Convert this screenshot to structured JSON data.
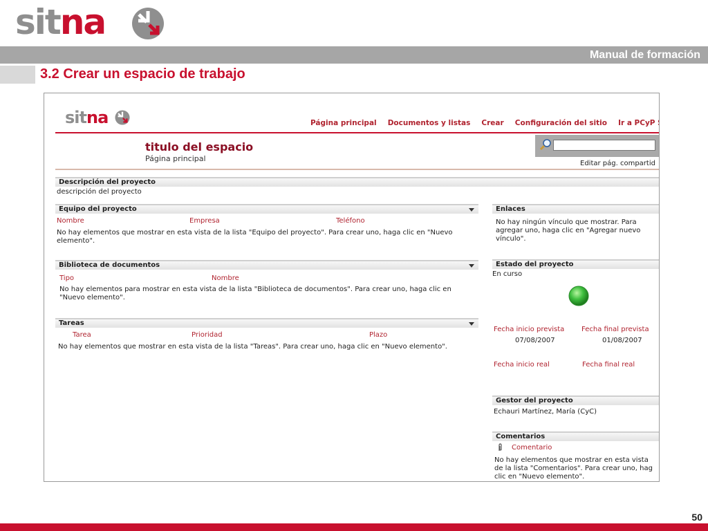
{
  "brand": {
    "sit": "sit",
    "na": "na"
  },
  "slide": {
    "band_text": "Manual de formación",
    "title": "3.2 Crear un espacio de trabajo",
    "page_number": "50"
  },
  "app": {
    "logo": {
      "sit": "sit",
      "na": "na"
    },
    "nav": [
      "Página principal",
      "Documentos y listas",
      "Crear",
      "Configuración del sitio",
      "Ir a PCyP SIT"
    ],
    "site_title": "titulo del espacio",
    "site_subtitle": "Página principal",
    "edit_link": "Editar pág. compartid",
    "description": {
      "header": "Descripción del proyecto",
      "text": "descripción del proyecto"
    },
    "team": {
      "header": "Equipo del proyecto",
      "columns": [
        "Nombre",
        "Empresa",
        "Teléfono"
      ],
      "empty_lines": [
        "No hay elementos que mostrar en esta vista de la lista \"Equipo del proyecto\". Para crear uno, haga clic en \"Nuevo",
        "elemento\"."
      ]
    },
    "library": {
      "header": "Biblioteca de documentos",
      "columns": [
        "Tipo",
        "Nombre"
      ],
      "empty_lines": [
        "No hay elementos para mostrar en esta vista de la lista \"Biblioteca de documentos\". Para crear uno, haga clic en",
        "\"Nuevo elemento\"."
      ]
    },
    "tasks": {
      "header": "Tareas",
      "columns": [
        "Tarea",
        "Prioridad",
        "Plazo"
      ],
      "empty_lines": [
        "No hay elementos que mostrar en esta vista de la lista \"Tareas\". Para crear uno, haga clic en \"Nuevo elemento\"."
      ]
    },
    "links": {
      "header": "Enlaces",
      "lines": [
        "No hay ningún vínculo que mostrar. Para",
        "agregar uno, haga clic en \"Agregar nuevo",
        "vínculo\"."
      ]
    },
    "status": {
      "header": "Estado del proyecto",
      "value": "En curso",
      "indicator_color": "#3fbf3f",
      "start_planned_label": "Fecha inicio prevista",
      "end_planned_label": "Fecha final prevista",
      "start_planned": "07/08/2007",
      "end_planned": "01/08/2007",
      "start_real_label": "Fecha inicio real",
      "end_real_label": "Fecha final real"
    },
    "manager": {
      "header": "Gestor del proyecto",
      "name": "Echauri Martínez, María (CyC)"
    },
    "comments": {
      "header": "Comentarios",
      "link": "Comentario",
      "lines": [
        "No hay elementos que mostrar en esta vista",
        "de la lista \"Comentarios\". Para crear uno, hag",
        "clic en \"Nuevo elemento\"."
      ]
    }
  },
  "colors": {
    "brand_red": "#c8102e",
    "brand_gray": "#8f8f8f",
    "band_gray": "#a6a6a6",
    "link_red": "#b0232f"
  }
}
